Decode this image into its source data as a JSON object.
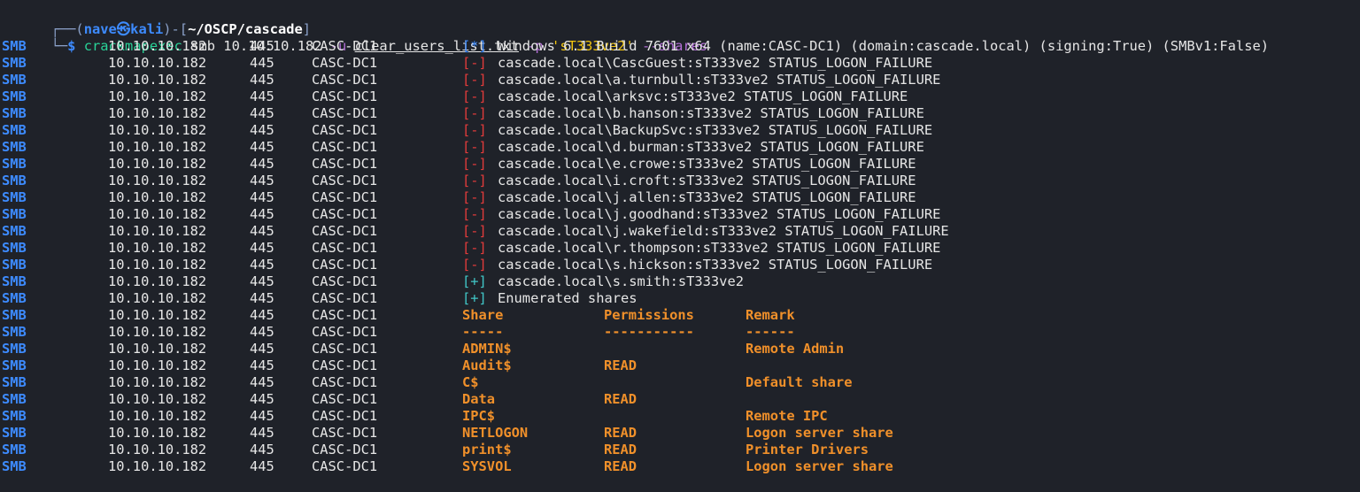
{
  "prompt": {
    "corner_top": "┌──(",
    "user": "nave",
    "at_symbol": "㉿",
    "host": "kali",
    "sep": ")-[",
    "path": "~/OSCP/cascade",
    "close": "]",
    "corner_bottom": "└─",
    "dollar": "$"
  },
  "command": {
    "program": "crackmapexec",
    "protocol": "smb",
    "target": "10.10.10.182",
    "user_flag": "-u",
    "user_file": "clear_users_list.txt",
    "pass_flag": "-p",
    "password": "'sT333ve2'",
    "shares_flag": "--shares"
  },
  "output_rows": [
    {
      "proto": "SMB",
      "ip": "10.10.10.182",
      "port": "445",
      "host": "CASC-DC1",
      "marker": "[*]",
      "marker_type": "info",
      "text": "Windows 6.1 Build 7601 x64 (name:CASC-DC1) (domain:cascade.local) (signing:True) (SMBv1:False)"
    },
    {
      "proto": "SMB",
      "ip": "10.10.10.182",
      "port": "445",
      "host": "CASC-DC1",
      "marker": "[-]",
      "marker_type": "fail",
      "text": "cascade.local\\CascGuest:sT333ve2 STATUS_LOGON_FAILURE"
    },
    {
      "proto": "SMB",
      "ip": "10.10.10.182",
      "port": "445",
      "host": "CASC-DC1",
      "marker": "[-]",
      "marker_type": "fail",
      "text": "cascade.local\\a.turnbull:sT333ve2 STATUS_LOGON_FAILURE"
    },
    {
      "proto": "SMB",
      "ip": "10.10.10.182",
      "port": "445",
      "host": "CASC-DC1",
      "marker": "[-]",
      "marker_type": "fail",
      "text": "cascade.local\\arksvc:sT333ve2 STATUS_LOGON_FAILURE"
    },
    {
      "proto": "SMB",
      "ip": "10.10.10.182",
      "port": "445",
      "host": "CASC-DC1",
      "marker": "[-]",
      "marker_type": "fail",
      "text": "cascade.local\\b.hanson:sT333ve2 STATUS_LOGON_FAILURE"
    },
    {
      "proto": "SMB",
      "ip": "10.10.10.182",
      "port": "445",
      "host": "CASC-DC1",
      "marker": "[-]",
      "marker_type": "fail",
      "text": "cascade.local\\BackupSvc:sT333ve2 STATUS_LOGON_FAILURE"
    },
    {
      "proto": "SMB",
      "ip": "10.10.10.182",
      "port": "445",
      "host": "CASC-DC1",
      "marker": "[-]",
      "marker_type": "fail",
      "text": "cascade.local\\d.burman:sT333ve2 STATUS_LOGON_FAILURE"
    },
    {
      "proto": "SMB",
      "ip": "10.10.10.182",
      "port": "445",
      "host": "CASC-DC1",
      "marker": "[-]",
      "marker_type": "fail",
      "text": "cascade.local\\e.crowe:sT333ve2 STATUS_LOGON_FAILURE"
    },
    {
      "proto": "SMB",
      "ip": "10.10.10.182",
      "port": "445",
      "host": "CASC-DC1",
      "marker": "[-]",
      "marker_type": "fail",
      "text": "cascade.local\\i.croft:sT333ve2 STATUS_LOGON_FAILURE"
    },
    {
      "proto": "SMB",
      "ip": "10.10.10.182",
      "port": "445",
      "host": "CASC-DC1",
      "marker": "[-]",
      "marker_type": "fail",
      "text": "cascade.local\\j.allen:sT333ve2 STATUS_LOGON_FAILURE"
    },
    {
      "proto": "SMB",
      "ip": "10.10.10.182",
      "port": "445",
      "host": "CASC-DC1",
      "marker": "[-]",
      "marker_type": "fail",
      "text": "cascade.local\\j.goodhand:sT333ve2 STATUS_LOGON_FAILURE"
    },
    {
      "proto": "SMB",
      "ip": "10.10.10.182",
      "port": "445",
      "host": "CASC-DC1",
      "marker": "[-]",
      "marker_type": "fail",
      "text": "cascade.local\\j.wakefield:sT333ve2 STATUS_LOGON_FAILURE"
    },
    {
      "proto": "SMB",
      "ip": "10.10.10.182",
      "port": "445",
      "host": "CASC-DC1",
      "marker": "[-]",
      "marker_type": "fail",
      "text": "cascade.local\\r.thompson:sT333ve2 STATUS_LOGON_FAILURE"
    },
    {
      "proto": "SMB",
      "ip": "10.10.10.182",
      "port": "445",
      "host": "CASC-DC1",
      "marker": "[-]",
      "marker_type": "fail",
      "text": "cascade.local\\s.hickson:sT333ve2 STATUS_LOGON_FAILURE"
    },
    {
      "proto": "SMB",
      "ip": "10.10.10.182",
      "port": "445",
      "host": "CASC-DC1",
      "marker": "[+]",
      "marker_type": "success",
      "text": "cascade.local\\s.smith:sT333ve2"
    },
    {
      "proto": "SMB",
      "ip": "10.10.10.182",
      "port": "445",
      "host": "CASC-DC1",
      "marker": "[+]",
      "marker_type": "success",
      "text": "Enumerated shares"
    }
  ],
  "shares_table": {
    "proto": "SMB",
    "ip": "10.10.10.182",
    "port": "445",
    "host": "CASC-DC1",
    "headers": [
      "Share",
      "Permissions",
      "Remark"
    ],
    "separators": [
      "-----",
      "-----------",
      "------"
    ],
    "rows": [
      {
        "share": "ADMIN$",
        "perm": "",
        "remark": "Remote Admin"
      },
      {
        "share": "Audit$",
        "perm": "READ",
        "remark": ""
      },
      {
        "share": "C$",
        "perm": "",
        "remark": "Default share"
      },
      {
        "share": "Data",
        "perm": "READ",
        "remark": ""
      },
      {
        "share": "IPC$",
        "perm": "",
        "remark": "Remote IPC"
      },
      {
        "share": "NETLOGON",
        "perm": "READ",
        "remark": "Logon server share"
      },
      {
        "share": "print$",
        "perm": "READ",
        "remark": "Printer Drivers"
      },
      {
        "share": "SYSVOL",
        "perm": "READ",
        "remark": "Logon server share"
      }
    ]
  },
  "colors": {
    "background": "#1f2229",
    "smb_blue": "#3d8bff",
    "fail_red": "#e23b3b",
    "success_teal": "#41c7c7",
    "shares_orange": "#f0902a",
    "prompt_green": "#29d398",
    "flag_purple": "#b36fd6",
    "string_yellow": "#f1c40f"
  }
}
